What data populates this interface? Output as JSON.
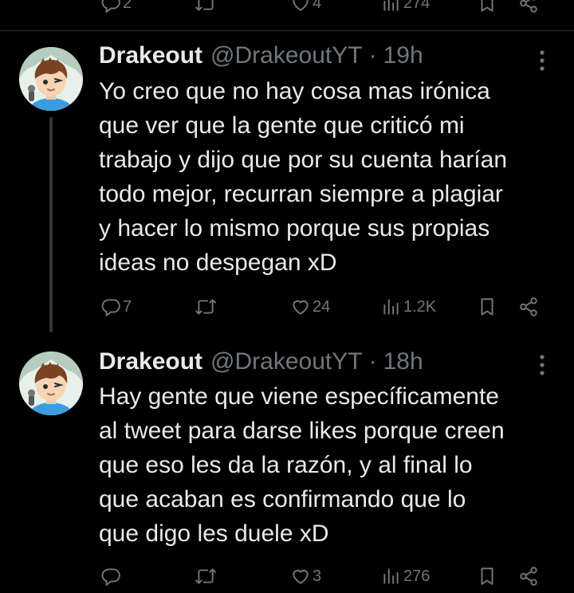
{
  "previous_tweet": {
    "replies": "2",
    "likes": "4",
    "views": "274"
  },
  "tweets": [
    {
      "author_name": "Drakeout",
      "author_handle": "@DrakeoutYT",
      "separator": "·",
      "time": "19h",
      "text": "Yo creo que no hay cosa mas irónica\nque ver que la gente que criticó mi\ntrabajo y dijo que por su cuenta harían\ntodo mejor, recurran siempre a plagiar\ny hacer lo mismo porque sus propias\nideas no despegan xD",
      "replies": "7",
      "retweets": "",
      "likes": "24",
      "views": "1.2K",
      "icons": [
        "reply-icon",
        "retweet-icon",
        "like-icon",
        "views-icon",
        "bookmark-icon",
        "share-icon",
        "more-icon"
      ]
    },
    {
      "author_name": "Drakeout",
      "author_handle": "@DrakeoutYT",
      "separator": "·",
      "time": "18h",
      "text": "Hay gente que viene específicamente\nal tweet para darse likes porque creen\nque eso les da la razón, y al final lo\nque acaban es confirmando que lo\nque digo les duele xD",
      "replies": "",
      "retweets": "",
      "likes": "3",
      "views": "276",
      "icons": [
        "reply-icon",
        "retweet-icon",
        "like-icon",
        "views-icon",
        "bookmark-icon",
        "share-icon",
        "more-icon"
      ]
    }
  ],
  "colors": {
    "background": "#000000",
    "text_primary": "#e7e9ea",
    "text_secondary": "#71767b",
    "divider": "#2f3336",
    "thread_line": "#333639"
  }
}
